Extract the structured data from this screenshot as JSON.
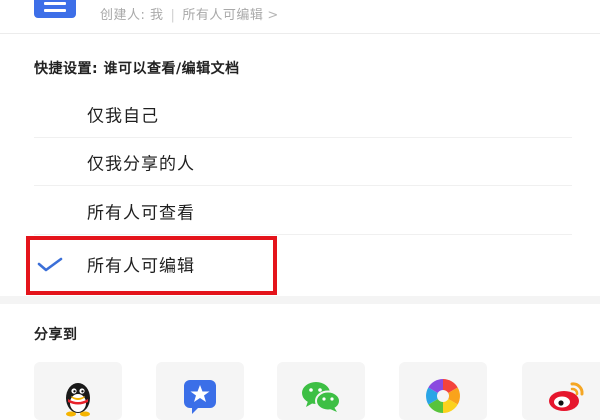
{
  "doc_header": {
    "creator": "创建人: 我",
    "permission": "所有人可编辑",
    "chevron": ">",
    "icon": "doc-icon"
  },
  "quick_settings": {
    "title": "快捷设置: 谁可以查看/编辑文档",
    "options": [
      {
        "label": "仅我自己",
        "selected": false
      },
      {
        "label": "仅我分享的人",
        "selected": false
      },
      {
        "label": "所有人可查看",
        "selected": false
      },
      {
        "label": "所有人可编辑",
        "selected": true
      }
    ],
    "check_icon": "checkmark-icon",
    "check_color": "#3b6fd8",
    "highlight_color": "#e4141b"
  },
  "share": {
    "title": "分享到",
    "targets": [
      {
        "icon": "qq-icon"
      },
      {
        "icon": "tim-star-icon"
      },
      {
        "icon": "wechat-icon"
      },
      {
        "icon": "photos-aperture-icon"
      },
      {
        "icon": "weibo-icon"
      }
    ]
  }
}
